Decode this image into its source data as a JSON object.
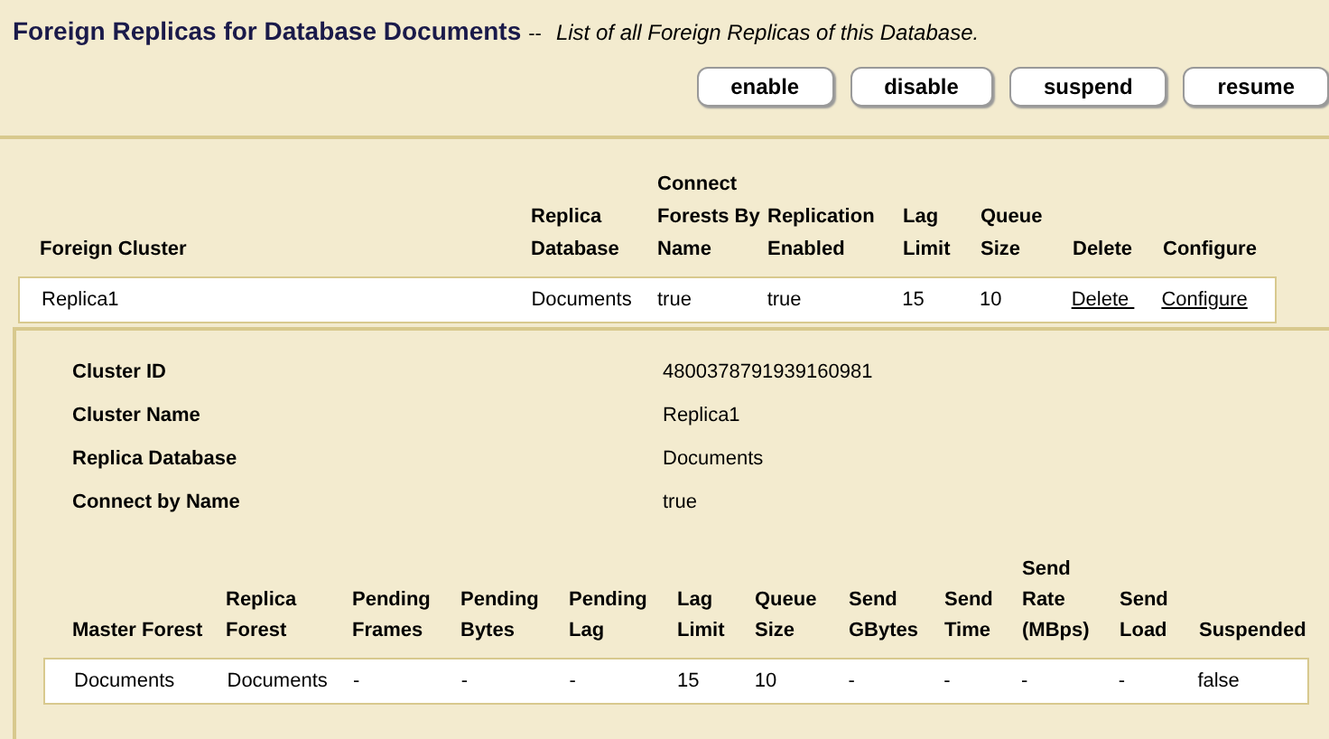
{
  "header": {
    "title": "Foreign Replicas for Database Documents",
    "separator": "--",
    "subtitle": "List of all Foreign Replicas of this Database."
  },
  "buttons": [
    "enable",
    "disable",
    "suspend",
    "resume"
  ],
  "replicas_table": {
    "columns": [
      "Foreign Cluster",
      "Replica Database",
      "Connect Forests By Name",
      "Replication Enabled",
      "Lag Limit",
      "Queue Size",
      "Delete",
      "Configure"
    ],
    "rows": [
      {
        "cells": [
          {
            "kind": "text",
            "text": "Replica1"
          },
          {
            "kind": "text",
            "text": "Documents"
          },
          {
            "kind": "text",
            "text": "true"
          },
          {
            "kind": "text",
            "text": "true"
          },
          {
            "kind": "text",
            "text": "15"
          },
          {
            "kind": "text",
            "text": "10"
          },
          {
            "kind": "link",
            "text": "Delete "
          },
          {
            "kind": "link",
            "text": "Configure"
          }
        ]
      }
    ]
  },
  "details": [
    {
      "label": "Cluster ID",
      "value": "4800378791939160981"
    },
    {
      "label": "Cluster Name",
      "value": "Replica1"
    },
    {
      "label": "Replica Database",
      "value": "Documents"
    },
    {
      "label": "Connect by Name",
      "value": "true"
    }
  ],
  "forests_table": {
    "columns": [
      "Master Forest",
      "Replica Forest",
      "Pending Frames",
      "Pending Bytes",
      "Pending Lag",
      "Lag Limit",
      "Queue Size",
      "Send GBytes",
      "Send Time",
      "Send Rate (MBps)",
      "Send Load",
      "Suspended"
    ],
    "rows": [
      {
        "cells": [
          "Documents",
          "Documents",
          "-",
          "-",
          "-",
          "15",
          "10",
          "-",
          "-",
          "-",
          "-",
          "false"
        ]
      }
    ]
  }
}
